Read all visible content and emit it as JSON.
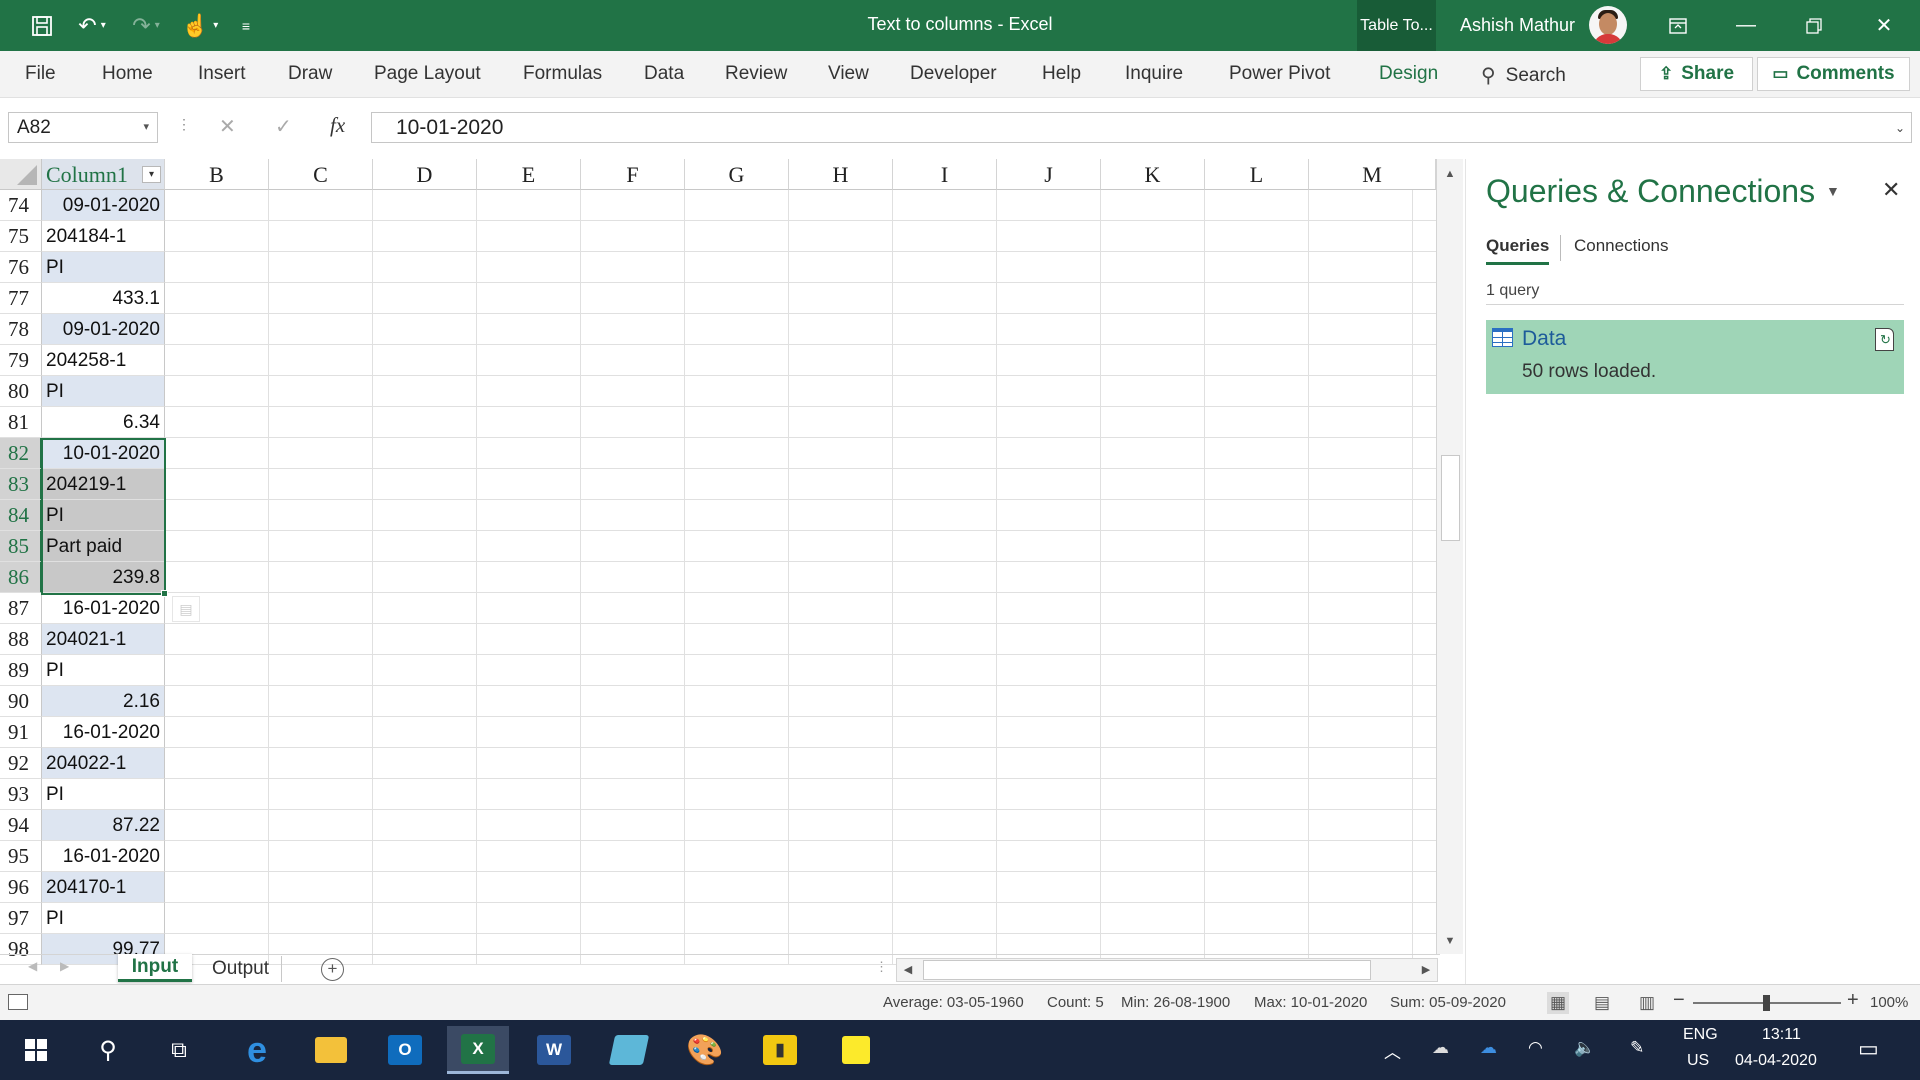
{
  "window": {
    "doc_title": "Text to columns  -  Excel",
    "contextual_tab": "Table To...",
    "user_name": "Ashish Mathur"
  },
  "colors": {
    "excel_green": "#217346",
    "band": "#dde5f1",
    "query_card": "#9fd5b7",
    "taskbar": "#18253d"
  },
  "quick_access": {
    "save_icon": "save-icon",
    "undo_icon": "undo-icon",
    "redo_icon": "redo-icon",
    "touch_icon": "touch-mode-icon",
    "customize_icon": "customize-qat-icon"
  },
  "ribbon": {
    "tabs": [
      "File",
      "Home",
      "Insert",
      "Draw",
      "Page Layout",
      "Formulas",
      "Data",
      "Review",
      "View",
      "Developer",
      "Help",
      "Inquire",
      "Power Pivot",
      "Design"
    ],
    "search_label": "Search",
    "share_label": "Share",
    "comments_label": "Comments"
  },
  "formula_bar": {
    "name_box": "A82",
    "fx": "fx",
    "value": "10-01-2020"
  },
  "sheet": {
    "column_a_header": "Column1",
    "columns": [
      "B",
      "C",
      "D",
      "E",
      "F",
      "G",
      "H",
      "I",
      "J",
      "K",
      "L",
      "M"
    ],
    "rows": [
      {
        "n": "74",
        "v": "09-01-2020",
        "num": true,
        "band": true
      },
      {
        "n": "75",
        "v": "204184-1",
        "num": false,
        "band": false
      },
      {
        "n": "76",
        "v": "PI",
        "num": false,
        "band": true
      },
      {
        "n": "77",
        "v": "433.1",
        "num": true,
        "band": false
      },
      {
        "n": "78",
        "v": "09-01-2020",
        "num": true,
        "band": true
      },
      {
        "n": "79",
        "v": "204258-1",
        "num": false,
        "band": false
      },
      {
        "n": "80",
        "v": "PI",
        "num": false,
        "band": true
      },
      {
        "n": "81",
        "v": "6.34",
        "num": true,
        "band": false
      },
      {
        "n": "82",
        "v": "10-01-2020",
        "num": true,
        "band": true,
        "sel": true,
        "active": true
      },
      {
        "n": "83",
        "v": "204219-1",
        "num": false,
        "band": false,
        "sel": true
      },
      {
        "n": "84",
        "v": "PI",
        "num": false,
        "band": true,
        "sel": true
      },
      {
        "n": "85",
        "v": "Part paid",
        "num": false,
        "band": false,
        "sel": true
      },
      {
        "n": "86",
        "v": "239.8",
        "num": true,
        "band": true,
        "sel": true
      },
      {
        "n": "87",
        "v": "16-01-2020",
        "num": true,
        "band": false
      },
      {
        "n": "88",
        "v": "204021-1",
        "num": false,
        "band": true
      },
      {
        "n": "89",
        "v": "PI",
        "num": false,
        "band": false
      },
      {
        "n": "90",
        "v": "2.16",
        "num": true,
        "band": true
      },
      {
        "n": "91",
        "v": "16-01-2020",
        "num": true,
        "band": false
      },
      {
        "n": "92",
        "v": "204022-1",
        "num": false,
        "band": true
      },
      {
        "n": "93",
        "v": "PI",
        "num": false,
        "band": false
      },
      {
        "n": "94",
        "v": "87.22",
        "num": true,
        "band": true
      },
      {
        "n": "95",
        "v": "16-01-2020",
        "num": true,
        "band": false
      },
      {
        "n": "96",
        "v": "204170-1",
        "num": false,
        "band": true
      },
      {
        "n": "97",
        "v": "PI",
        "num": false,
        "band": false
      },
      {
        "n": "98",
        "v": "99.77",
        "num": true,
        "band": true
      }
    ],
    "sheet_tabs": [
      "Input",
      "Output"
    ],
    "active_sheet": "Input"
  },
  "panel": {
    "title": "Queries & Connections",
    "tab_queries": "Queries",
    "tab_connections": "Connections",
    "count_text": "1 query",
    "query_name": "Data",
    "query_status": "50 rows loaded."
  },
  "status_bar": {
    "average": "Average: 03-05-1960",
    "count": "Count: 5",
    "min": "Min: 26-08-1900",
    "max": "Max: 10-01-2020",
    "sum": "Sum: 05-09-2020",
    "zoom": "100%"
  },
  "taskbar": {
    "lang": "ENG",
    "region": "US",
    "time": "13:11",
    "date": "04-04-2020"
  }
}
